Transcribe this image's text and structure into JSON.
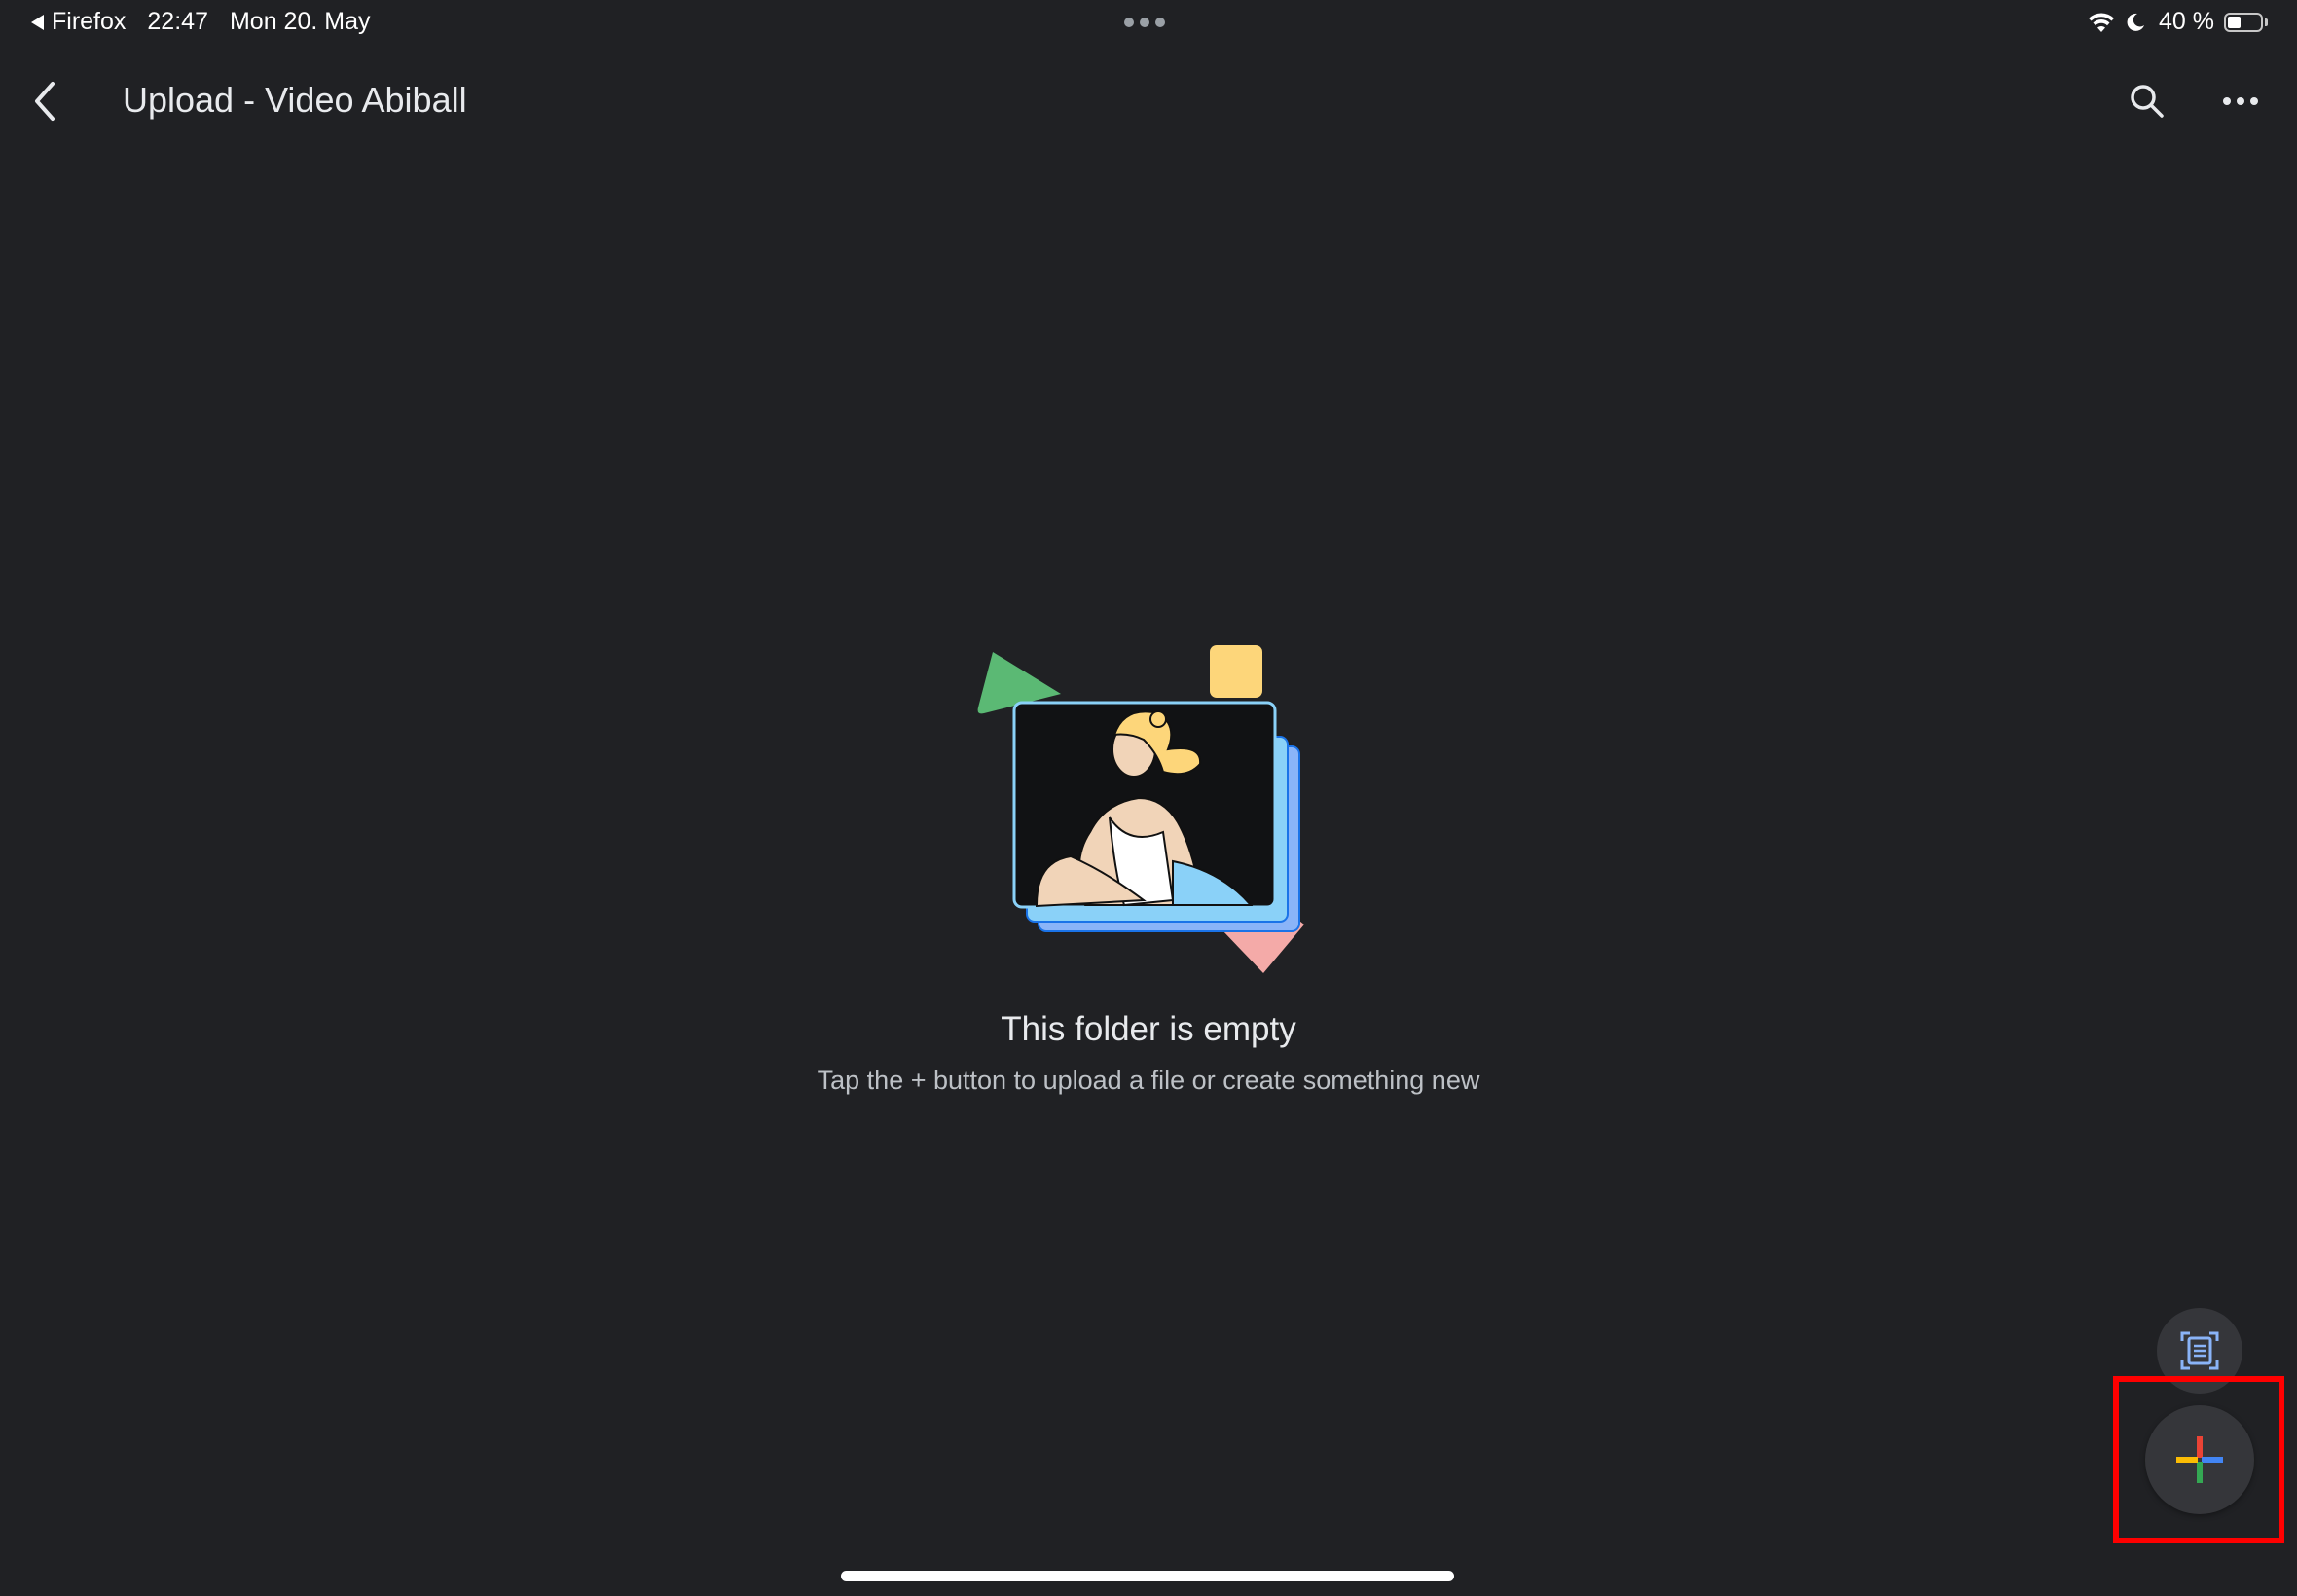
{
  "status_bar": {
    "back_app": "Firefox",
    "time": "22:47",
    "date": "Mon 20. May",
    "battery_percent_label": "40 %",
    "battery_level": 0.4
  },
  "app_bar": {
    "title": "Upload - Video Abiball",
    "back_icon": "chevron-left-icon",
    "search_icon": "search-icon",
    "more_icon": "more-horizontal-icon"
  },
  "empty_state": {
    "title": "This folder is empty",
    "subtitle": "Tap the + button to upload a file or create something new"
  },
  "fabs": {
    "scan_icon": "document-scan-icon",
    "new_icon": "plus-icon"
  },
  "colors": {
    "background": "#202124",
    "fab": "#35363a",
    "highlight": "#ff0000",
    "google_red": "#ea4335",
    "google_blue": "#4285f4",
    "google_green": "#34a853",
    "google_yellow": "#fbbc04"
  }
}
